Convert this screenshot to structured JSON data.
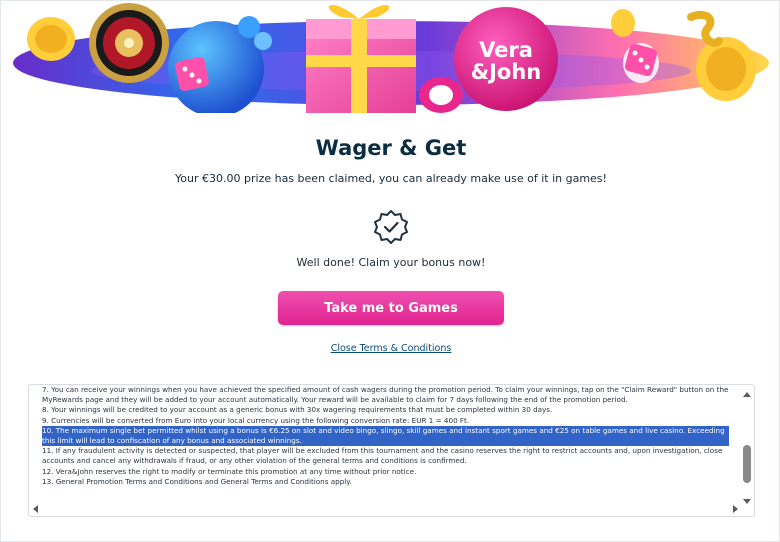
{
  "banner": {
    "logo_line1": "Vera",
    "logo_line2": "&John",
    "colors": {
      "pink": "#e8268c",
      "blue": "#2a6ff0",
      "purple": "#6a2cc9",
      "yellow": "#ffd84a",
      "orange": "#ff8a2a"
    }
  },
  "title": "Wager & Get",
  "subtitle": "Your €30.00 prize has been claimed, you can already make use of it in games!",
  "badge_icon": "verified-badge-icon",
  "well_done": "Well done! Claim your bonus now!",
  "cta_label": "Take me to Games",
  "close_terms_label": "Close Terms & Conditions",
  "terms": [
    "7. You can receive your winnings when you have achieved the specified amount of cash wagers during the promotion period. To claim your winnings, tap on the \"Claim Reward\" button on the MyRewards page and they will be added to your account automatically. Your reward will be available to claim for 7 days following the end of the promotion period.",
    "8. Your winnings will be credited to your account as a generic bonus with 30x wagering requirements that must be completed within 30 days.",
    "9. Currencies will be converted from Euro into your local currency using the following conversion rate: EUR 1 = 400 Ft.",
    "10. The maximum single bet permitted whilst using a bonus is €6.25 on slot and video bingo, slingo, skill games and instant sport games and €25 on table games and live casino. Exceeding this limit will lead to confiscation of any bonus and associated winnings.",
    "11. If any fraudulent activity is detected or suspected, that player will be excluded from this tournament and the casino reserves the right to restrict accounts and, upon investigation, close accounts and cancel any withdrawals if fraud, or any other violation of the general terms and conditions is confirmed.",
    "12. Vera&John reserves the right to modify or terminate this promotion at any time without prior notice.",
    "13. General Promotion Terms and Conditions and General Terms and Conditions apply."
  ],
  "colors": {
    "title": "#0b2d44",
    "cta": "#e0238f",
    "highlight": "#3264c8",
    "link": "#0b4a78"
  }
}
